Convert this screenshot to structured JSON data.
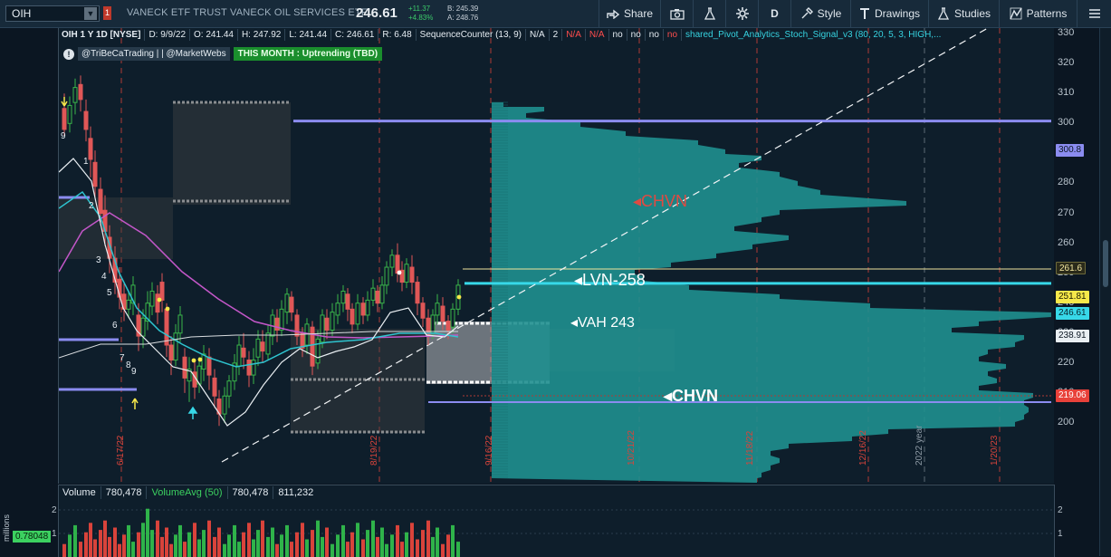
{
  "toolbar": {
    "symbol": "OIH",
    "symbol_caret": "▼",
    "link_flag": "1",
    "description": "VANECK ETF TRUST VANECK OIL SERVICES ETF",
    "last_price": "246.61",
    "net_change": "+11.37",
    "pct_change": "+4.83%",
    "bid": "B: 245.39",
    "ask": "A: 248.76",
    "share_label": "Share",
    "aggregation_label": "D",
    "style_label": "Style",
    "drawings_label": "Drawings",
    "studies_label": "Studies",
    "patterns_label": "Patterns"
  },
  "header": {
    "chart_label": "OIH 1 Y 1D [NYSE]",
    "date": "D: 9/9/22",
    "open": "O: 241.44",
    "high": "H: 247.92",
    "low": "L: 241.44",
    "close": "C: 246.61",
    "range": "R: 6.48",
    "study1": "SequenceCounter (13, 9)",
    "s1": "N/A",
    "s2": "2",
    "s3": "N/A",
    "s4": "N/A",
    "s5": "no",
    "s6": "no",
    "s7": "no",
    "s8": "no",
    "study2": "shared_Pivot_Analytics_Stoch_Signal_v3 (80, 20, 5, 3, HIGH,..."
  },
  "tags": {
    "notice": "!",
    "credit": "@TriBeCaTrading | | @MarketWebs",
    "trend": "THIS MONTH : Uptrending (TBD)"
  },
  "annotations": {
    "chvn_top": "CHVN",
    "lvn": "LVN-258",
    "vah": "VAH 243",
    "chvn_bottom": "CHVN"
  },
  "date_labels": [
    "6/17/22",
    "8/19/22",
    "9/16/22",
    "10/21/22",
    "11/18/22",
    "12/16/22",
    "2022 year",
    "1/20/23"
  ],
  "price_axis": [
    "330",
    "320",
    "310",
    "300",
    "290",
    "280",
    "270",
    "260",
    "250",
    "240",
    "230",
    "220",
    "210",
    "200"
  ],
  "price_tags": {
    "pivot_300": "300.8",
    "level_261": "261.6",
    "level_251": "251.81",
    "last": "246.61",
    "level_238": "238.91",
    "level_219": "219.06"
  },
  "sequence_labels": [
    "9",
    "1",
    "2",
    "3",
    "4",
    "5",
    "6",
    "7",
    "8",
    "9"
  ],
  "volume": {
    "label": "Volume",
    "value": "780,478",
    "avg_label": "VolumeAvg (50)",
    "avg_value": "780,478",
    "avg2": "811,232",
    "axis_title": "millions",
    "current_tag": "0.78048",
    "axis_left": [
      "2",
      "1"
    ],
    "axis_right": [
      "2",
      "1"
    ]
  },
  "colors": {
    "bull": "#39b54a",
    "bear": "#e05757",
    "profile": "#1f8f8f",
    "pivot": "#8b8cf0",
    "last": "#37d8e8",
    "accent": "#e03b3b"
  }
}
